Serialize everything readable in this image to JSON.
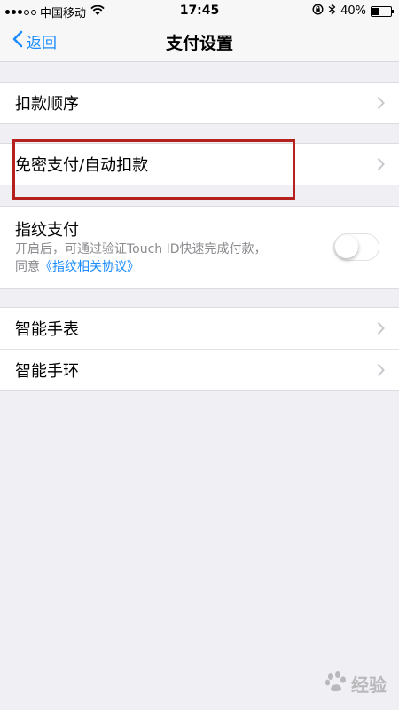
{
  "status_bar": {
    "carrier": "中国移动",
    "time": "17:45",
    "battery": "40%",
    "battery_level": 0.4
  },
  "nav": {
    "back_label": "返回",
    "title": "支付设置"
  },
  "settings": {
    "deduct_order": "扣款顺序",
    "auto_deduct": "免密支付/自动扣款",
    "fingerprint_title": "指纹支付",
    "fingerprint_desc_line1": "开启后，可通过验证Touch ID快速完成付款，",
    "fingerprint_desc_prefix": "同意",
    "fingerprint_agreement": "《指纹相关协议》",
    "fingerprint_enabled": false,
    "smart_watch": "智能手表",
    "smart_band": "智能手环"
  },
  "watermark": {
    "text": "经验"
  },
  "colors": {
    "accent": "#1a8cff",
    "highlight": "#b5211e",
    "background": "#efeff4"
  }
}
